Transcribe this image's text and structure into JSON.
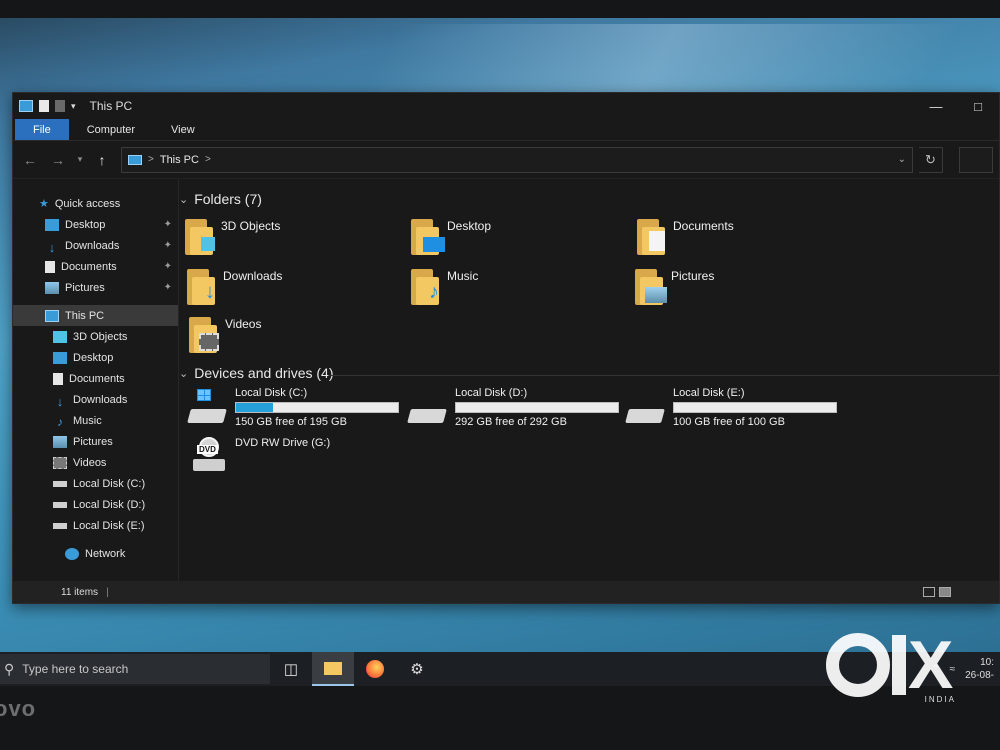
{
  "window": {
    "title": "This PC"
  },
  "ribbon": {
    "tabs": [
      "File",
      "Computer",
      "View"
    ]
  },
  "address": {
    "path": "This PC",
    "separator": ">"
  },
  "sidebar": {
    "quick_access": "Quick access",
    "quick_items": [
      "Desktop",
      "Downloads",
      "Documents",
      "Pictures"
    ],
    "this_pc": "This PC",
    "pc_items": [
      "3D Objects",
      "Desktop",
      "Documents",
      "Downloads",
      "Music",
      "Pictures",
      "Videos",
      "Local Disk (C:)",
      "Local Disk (D:)",
      "Local Disk (E:)"
    ],
    "network": "Network"
  },
  "folders": {
    "header": "Folders (7)",
    "items": [
      "3D Objects",
      "Desktop",
      "Documents",
      "Downloads",
      "Music",
      "Pictures",
      "Videos"
    ]
  },
  "drives": {
    "header": "Devices and drives (4)",
    "items": [
      {
        "name": "Local Disk (C:)",
        "free": "150 GB free of 195 GB",
        "used_fraction": 0.23
      },
      {
        "name": "Local Disk (D:)",
        "free": "292 GB free of 292 GB",
        "used_fraction": 0.0
      },
      {
        "name": "Local Disk (E:)",
        "free": "100 GB free of 100 GB",
        "used_fraction": 0.0
      }
    ],
    "dvd": {
      "name": "DVD RW Drive (G:)",
      "badge": "DVD"
    }
  },
  "status": {
    "items": "11 items",
    "separator": "|"
  },
  "taskbar": {
    "search_placeholder": "Type here to search",
    "clock_time": "10:",
    "clock_date": "26-08-"
  },
  "brand": {
    "laptop": "ovo",
    "watermark_country": "INDIA"
  },
  "colors": {
    "accent": "#2b6fbf",
    "drive_fill": "#26a0da",
    "folder": "#f3c862"
  }
}
